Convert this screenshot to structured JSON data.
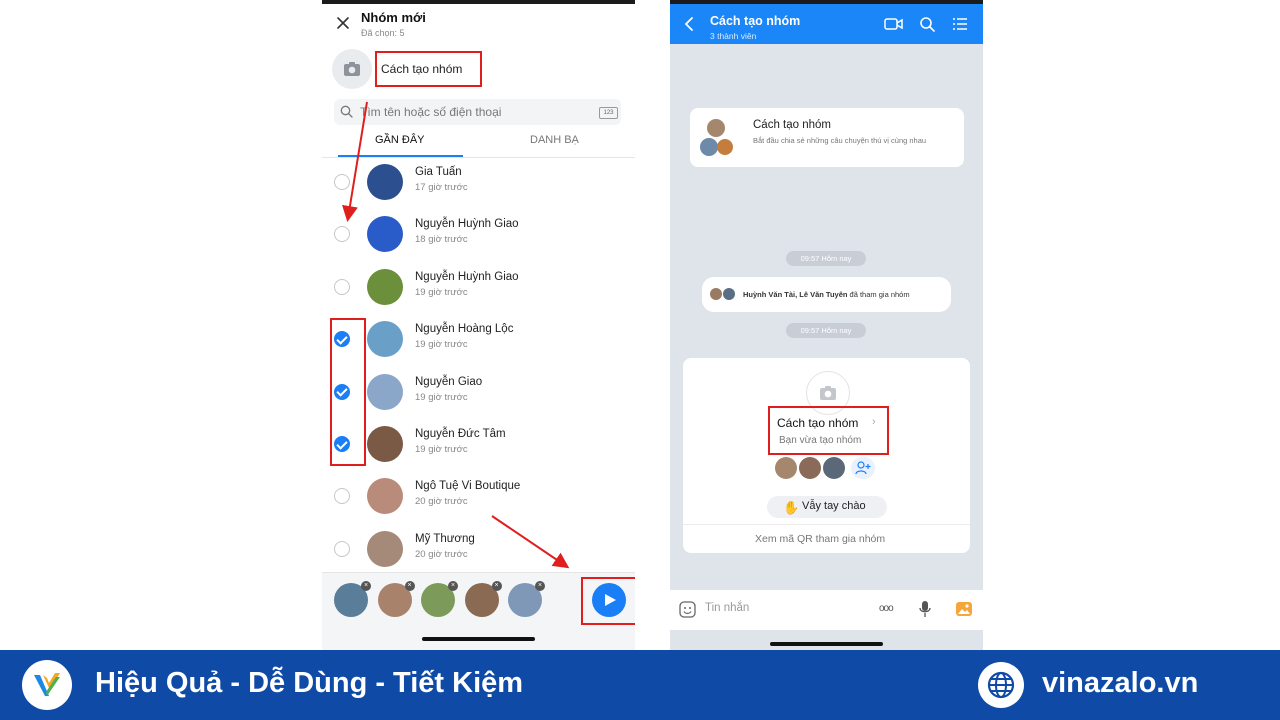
{
  "left_screen": {
    "title": "Nhóm mới",
    "selected_count": "Đã chọn: 5",
    "group_name": "Cách tạo nhóm",
    "search_placeholder": "Tìm tên hoặc số điện thoại",
    "keypad_label": "123",
    "tabs": [
      {
        "label": "GẦN ĐÂY",
        "active": true
      },
      {
        "label": "DANH BẠ",
        "active": false
      }
    ],
    "contacts": [
      {
        "name": "Gia Tuấn",
        "time": "17 giờ trước",
        "checked": false,
        "avatar_color": "#2b4f8f"
      },
      {
        "name": "Nguyễn Huỳnh Giao",
        "time": "18 giờ trước",
        "checked": false,
        "avatar_color": "#2a5cc9"
      },
      {
        "name": "Nguyễn Huỳnh Giao",
        "time": "19 giờ trước",
        "checked": false,
        "avatar_color": "#6b8f3a"
      },
      {
        "name": "Nguyễn Hoàng Lộc",
        "time": "19 giờ trước",
        "checked": true,
        "avatar_color": "#6aa0c8"
      },
      {
        "name": "Nguyễn Giao",
        "time": "19 giờ trước",
        "checked": true,
        "avatar_color": "#8aa7c9"
      },
      {
        "name": "Nguyễn Đức Tâm",
        "time": "19 giờ trước",
        "checked": true,
        "avatar_color": "#7a5a45"
      },
      {
        "name": "Ngô Tuệ Vi Boutique",
        "time": "20 giờ trước",
        "checked": false,
        "avatar_color": "#b98b7a"
      },
      {
        "name": "Mỹ Thương",
        "time": "20 giờ trước",
        "checked": false,
        "avatar_color": "#a58a79"
      }
    ],
    "selected_avatars": [
      "#5a7d9a",
      "#a8826b",
      "#7c9b5a",
      "#8a6a52",
      "#7f98b8"
    ],
    "remove_glyph": "×"
  },
  "right_screen": {
    "title": "Cách tạo nhóm",
    "member_count": "3 thành viên",
    "intro_title": "Cách tạo nhóm",
    "intro_desc": "Bắt đầu chia sẻ những câu chuyện thú vị cùng nhau",
    "time_pill_1": "09:57 Hôm nay",
    "join_names": "Huỳnh Văn Tài, Lê Văn Tuyên",
    "join_suffix": " đã tham gia nhóm",
    "time_pill_2": "09:57 Hôm nay",
    "card_title": "Cách tạo nhóm",
    "card_sub": "Bạn vừa tạo nhóm",
    "wave_label": "Vẫy tay chào",
    "qr_text": "Xem mã QR tham gia nhóm",
    "input_placeholder": "Tin nhắn",
    "more_glyph": "ooo"
  },
  "footer": {
    "slogan": "Hiệu Quả - Dễ Dùng - Tiết Kiệm",
    "site": "vinazalo.vn"
  },
  "colors": {
    "accent": "#1a7ef6",
    "highlight_red": "#e01e1e",
    "footer_bg": "#0e4aa6"
  }
}
